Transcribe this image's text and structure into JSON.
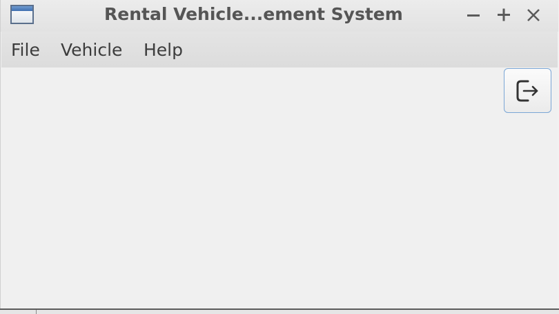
{
  "window": {
    "title": "Rental Vehicle...ement System",
    "controls": {
      "minimize_icon": "minimize-icon",
      "maximize_icon": "maximize-icon",
      "close_icon": "close-icon"
    }
  },
  "menubar": {
    "items": [
      {
        "label": "File"
      },
      {
        "label": "Vehicle"
      },
      {
        "label": "Help"
      }
    ]
  },
  "toolbar": {
    "exit_icon": "logout-icon"
  },
  "colors": {
    "accent_border": "#7aa6d6",
    "title_text": "#555555",
    "menu_text": "#3c3c3c",
    "background": "#f0f0f0"
  }
}
